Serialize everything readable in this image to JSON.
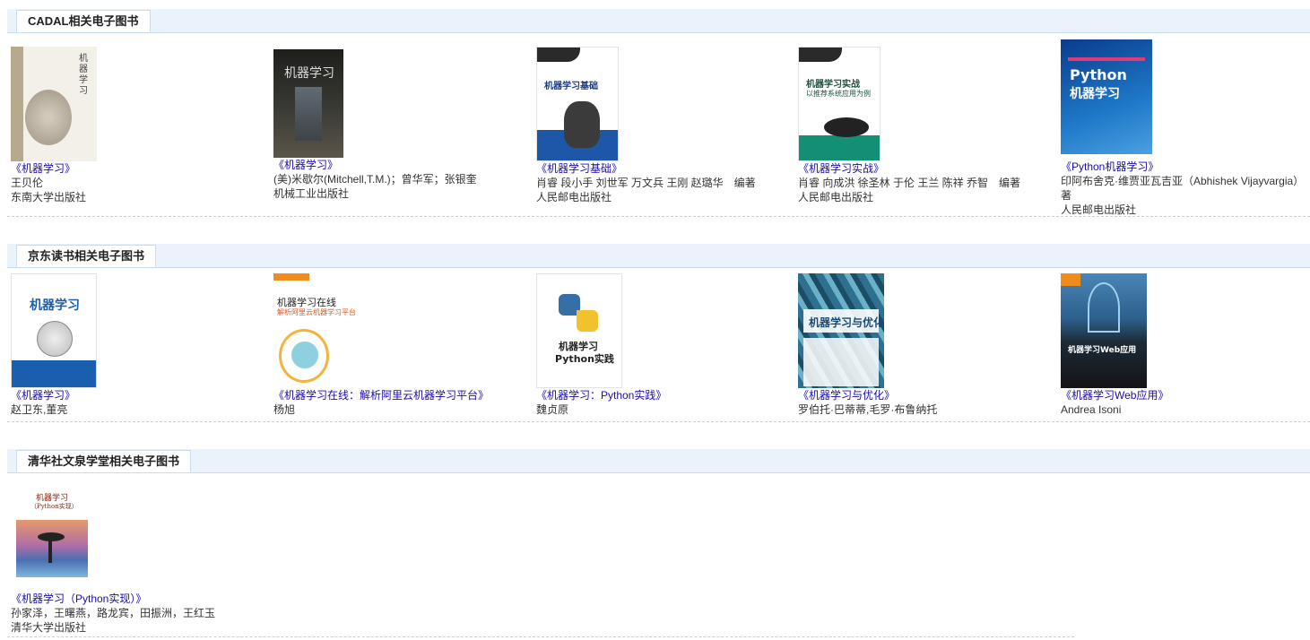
{
  "sections": [
    {
      "title": "CADAL相关电子图书",
      "books": [
        {
          "title": "《机器学习》",
          "author": "王贝伦",
          "publisher": "东南大学出版社",
          "cover": {
            "text": "机器学习"
          }
        },
        {
          "title": "《机器学习》",
          "author": "(美)米歇尔(Mitchell,T.M.)；曾华军；张银奎",
          "publisher": "机械工业出版社",
          "cover": {
            "text": "机器学习"
          }
        },
        {
          "title": "《机器学习基础》",
          "author": "肖睿 段小手 刘世军 万文兵 王刚 赵璐华　编著",
          "publisher": "人民邮电出版社",
          "cover": {
            "text": "机器学习基础"
          }
        },
        {
          "title": "《机器学习实战》",
          "author": "肖睿 向成洪 徐圣林 于伦 王兰 陈祥 乔智　编著",
          "publisher": "人民邮电出版社",
          "cover": {
            "text": "机器学习实战",
            "sub": "以推荐系统应用为例"
          }
        },
        {
          "title": "《Python机器学习》",
          "author": "印阿布舍克·维贾亚瓦吉亚（Abhishek Vijayvargia）著",
          "publisher": "人民邮电出版社",
          "cover": {
            "text": "Python",
            "sub": "机器学习"
          }
        }
      ]
    },
    {
      "title": "京东读书相关电子图书",
      "books": [
        {
          "title": "《机器学习》",
          "author": "赵卫东,董亮",
          "cover": {
            "text": "机器学习"
          }
        },
        {
          "title": "《机器学习在线：解析阿里云机器学习平台》",
          "author": "杨旭",
          "cover": {
            "text": "机器学习在线",
            "sub": "解析阿里云机器学习平台"
          }
        },
        {
          "title": "《机器学习：Python实践》",
          "author": "魏贞原",
          "cover": {
            "text": "机器学习",
            "sub": "Python实践"
          }
        },
        {
          "title": "《机器学习与优化》",
          "author": "罗伯托·巴蒂蒂,毛罗·布鲁纳托",
          "cover": {
            "text": "机器学习与优化"
          }
        },
        {
          "title": "《机器学习Web应用》",
          "author": "Andrea Isoni",
          "cover": {
            "text": "机器学习Web应用"
          }
        }
      ]
    },
    {
      "title": "清华社文泉学堂相关电子图书",
      "books": [
        {
          "title": "《机器学习（Python实现）》",
          "author": "孙家泽，王曙燕，路龙宾，田振洲，王红玉",
          "publisher": "清华大学出版社",
          "cover": {
            "text": "机器学习",
            "sub": "（Python实现）"
          }
        }
      ]
    }
  ]
}
